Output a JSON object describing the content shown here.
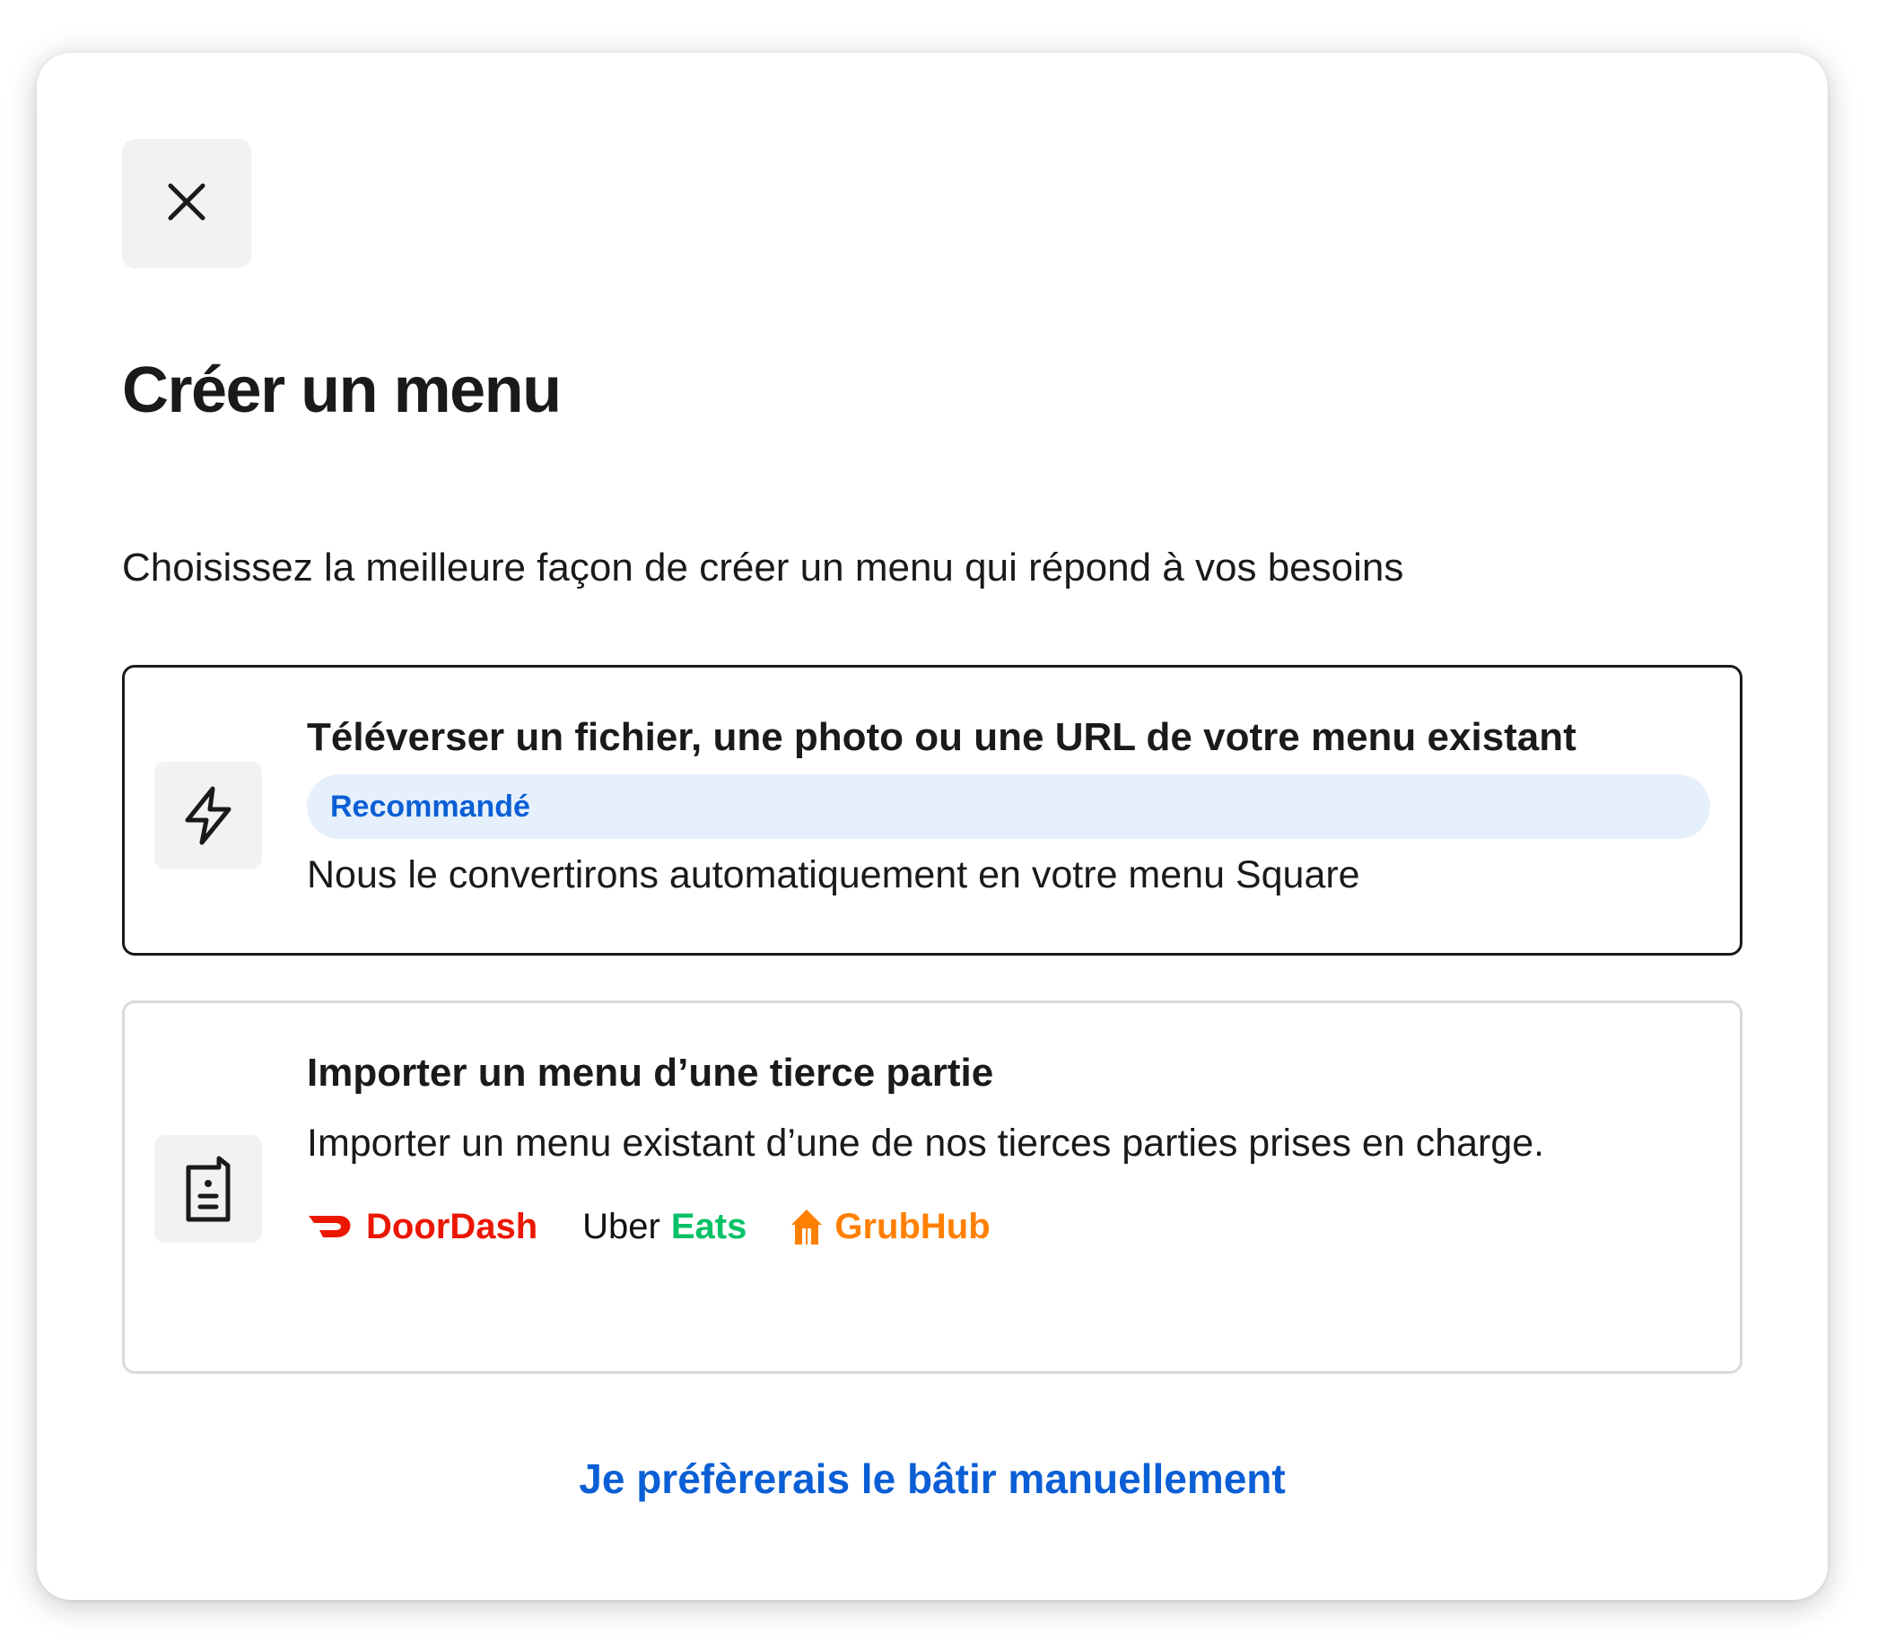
{
  "dialog": {
    "close_icon": "close-icon",
    "title": "Créer un menu",
    "subtitle": "Choisissez la meilleure façon de créer un menu qui répond à vos besoins"
  },
  "options": [
    {
      "icon": "lightning-bolt-icon",
      "title": "Téléverser un fichier, une photo ou une URL de votre menu existant",
      "badge": "Recommandé",
      "description": "Nous le convertirons automatiquement en votre menu Square",
      "selected": true
    },
    {
      "icon": "clipboard-menu-icon",
      "title": "Importer un menu d’une tierce partie",
      "description": "Importer un menu existant d’une de nos tierces parties prises en charge.",
      "selected": false,
      "partners": {
        "doordash": "DoorDash",
        "uber": "Uber",
        "eats": "Eats",
        "grubhub": "GrubHub"
      }
    }
  ],
  "manual_link": "Je préfèrerais le bâtir manuellement",
  "colors": {
    "link_blue": "#0b5fd6",
    "badge_bg": "#e6f0fd",
    "doordash_red": "#eb1700",
    "uber_eats_green": "#06c167",
    "grubhub_orange": "#ff8000"
  }
}
